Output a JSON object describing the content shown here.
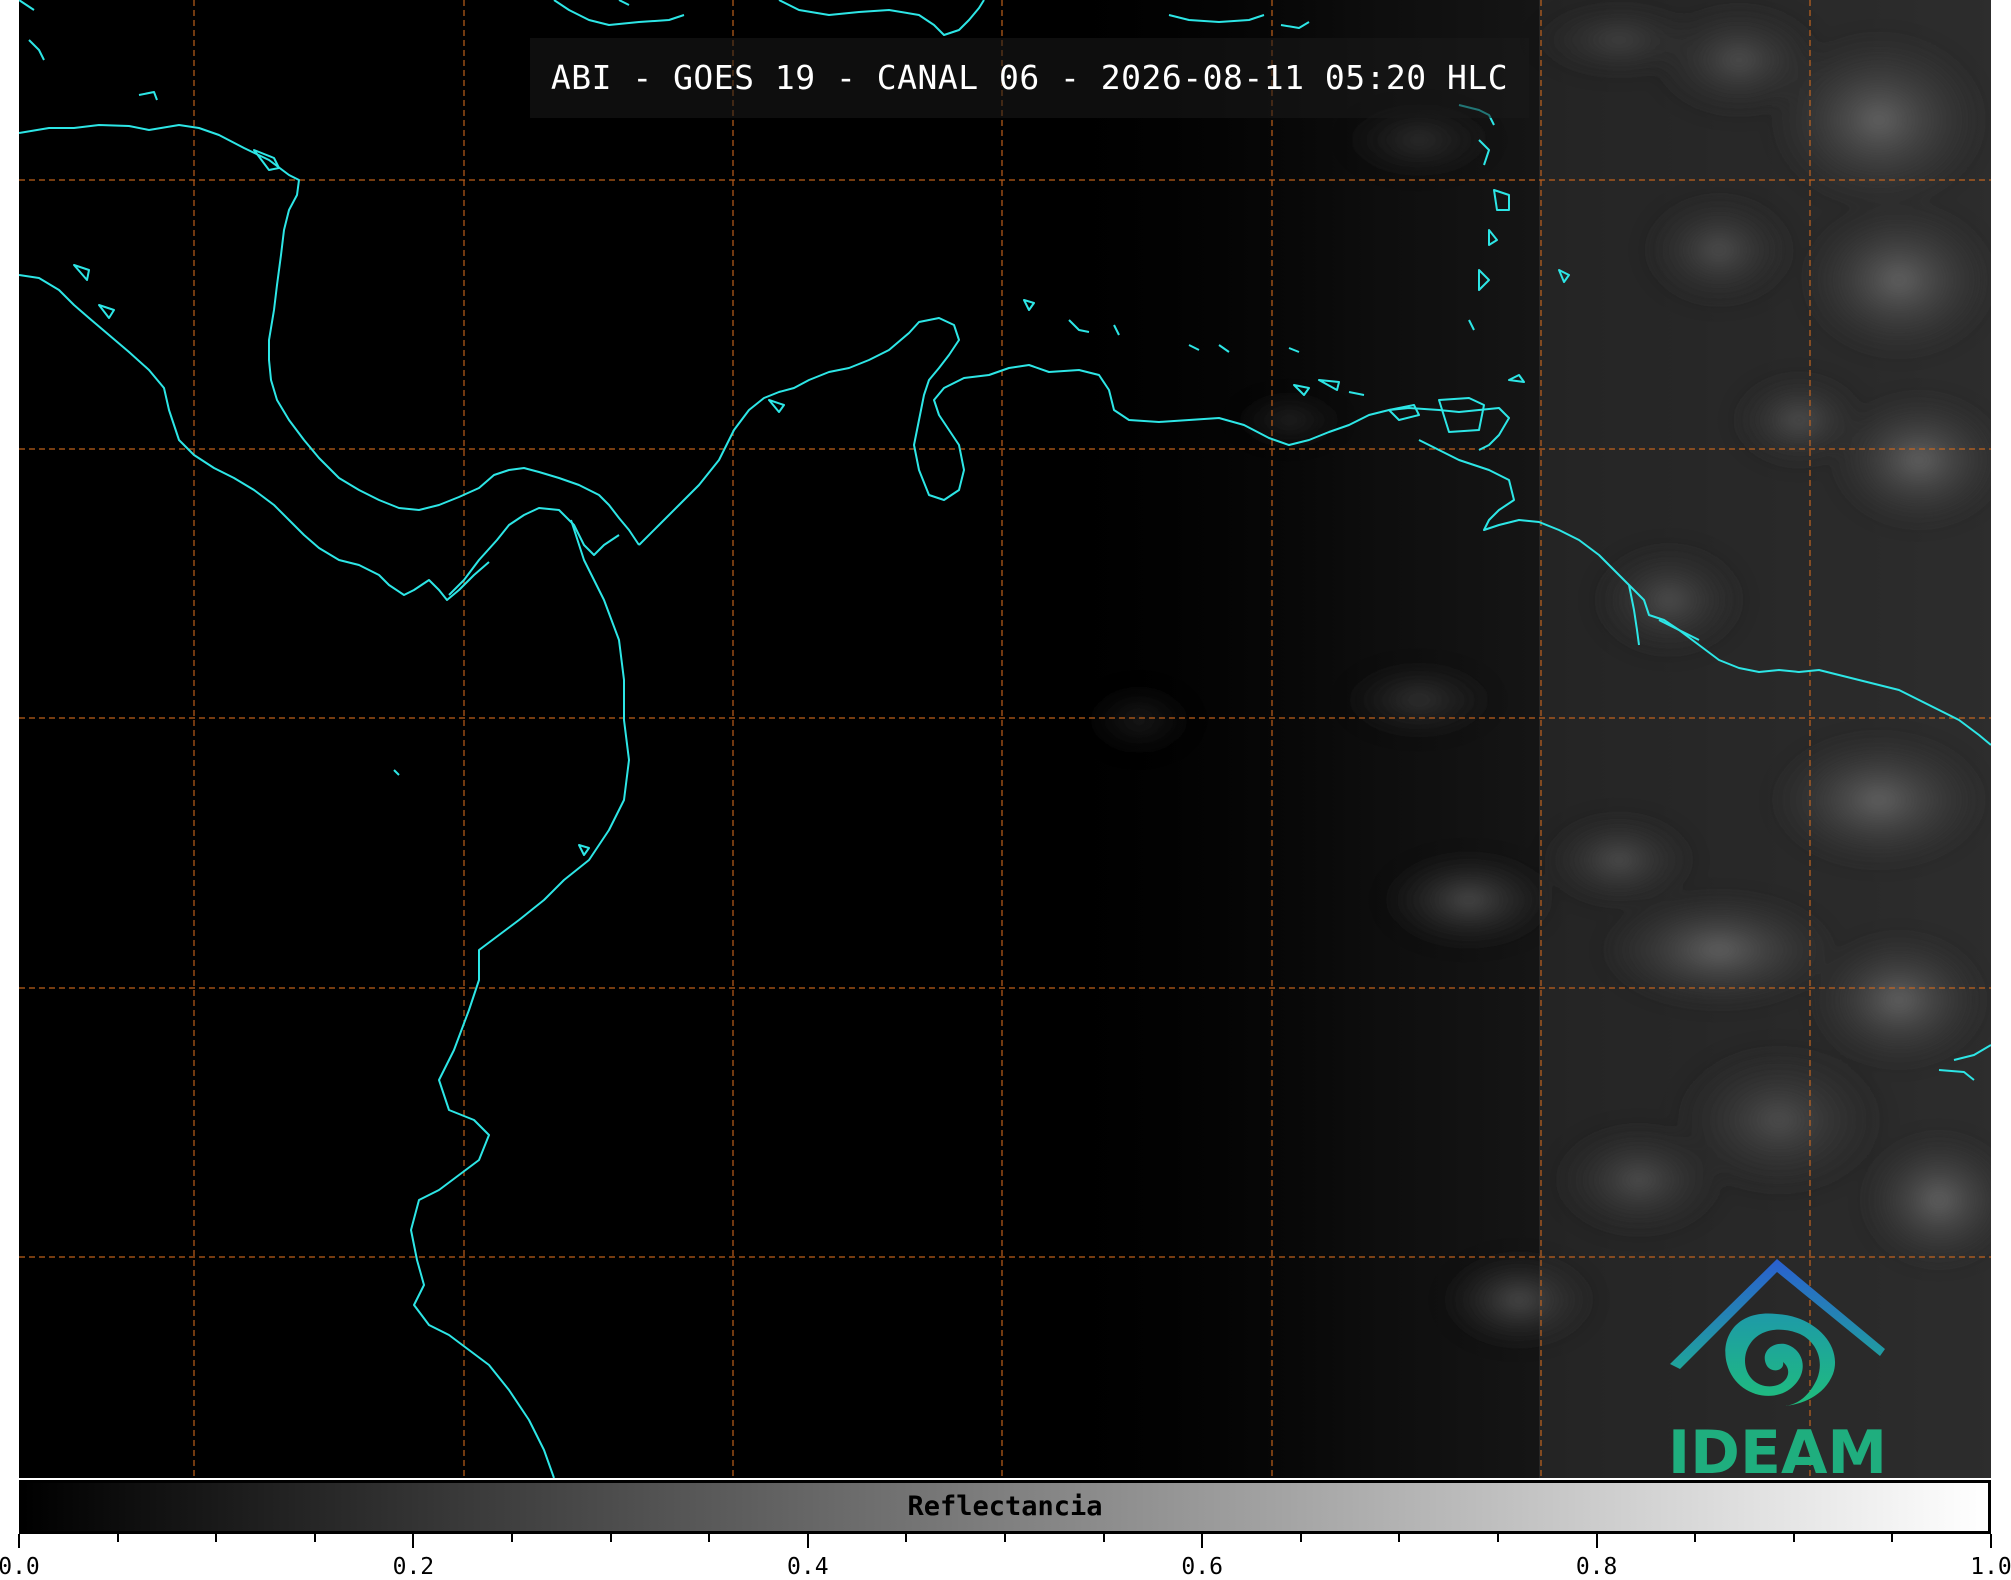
{
  "title": "ABI - GOES 19 - CANAL 06 - 2026-08-11 05:20 HLC",
  "colorbar": {
    "label": "Reflectancia",
    "range": [
      0.0,
      1.0
    ],
    "ticks_major": [
      "0.0",
      "0.2",
      "0.4",
      "0.6",
      "0.8",
      "1.0"
    ],
    "colormap": "black-to-white grayscale"
  },
  "logo": {
    "text": "IDEAM",
    "icon": "ideam-logo-icon"
  },
  "colors": {
    "coastline": "#2de6e6",
    "gridline": "#d26a1e",
    "logo_green": "#1fae7e",
    "logo_blue": "#2a74c8"
  },
  "map": {
    "gridlines": "dashed",
    "grid_columns": 7,
    "grid_rows": 5
  }
}
